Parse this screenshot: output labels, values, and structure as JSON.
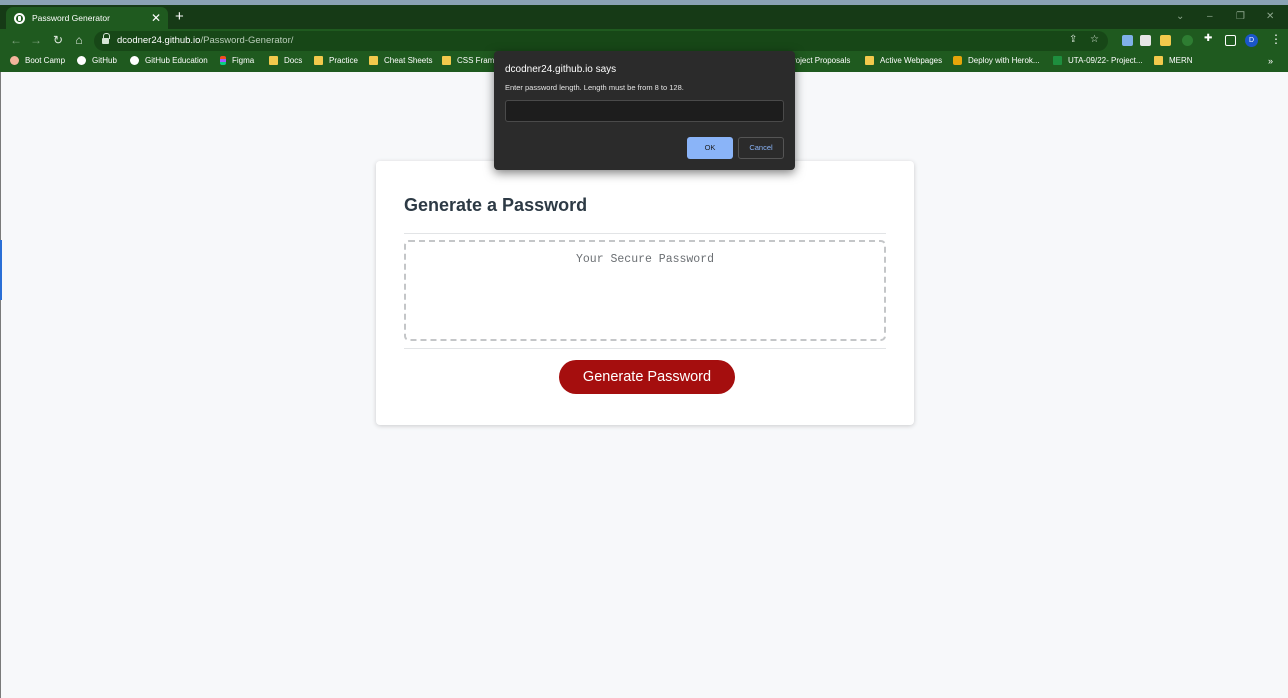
{
  "browser": {
    "tab": {
      "title": "Password Generator",
      "close": "✕"
    },
    "new_tab": "+",
    "window_controls": {
      "minimize": "–",
      "restore": "❐",
      "close": "✕",
      "tab_search": "⌄"
    },
    "url_host": "dcodner24.github.io",
    "url_path": "/Password-Generator/",
    "profile_initial": "D",
    "bookmarks": [
      {
        "label": "Boot Camp",
        "icon": "boot-camp-icon"
      },
      {
        "label": "GitHub",
        "icon": "github-icon"
      },
      {
        "label": "GitHub Education",
        "icon": "github-icon"
      },
      {
        "label": "Figma",
        "icon": "figma-icon"
      },
      {
        "label": "Docs",
        "icon": "folder-icon"
      },
      {
        "label": "Practice",
        "icon": "folder-icon"
      },
      {
        "label": "Cheat Sheets",
        "icon": "folder-icon"
      },
      {
        "label": "CSS Frame",
        "icon": "folder-icon"
      },
      {
        "label": "roject Proposals",
        "icon": "folder-icon"
      },
      {
        "label": "Active Webpages",
        "icon": "folder-icon"
      },
      {
        "label": "Deploy with Herok...",
        "icon": "heroku-icon"
      },
      {
        "label": "UTA-09/22- Project...",
        "icon": "sheets-icon"
      },
      {
        "label": "MERN",
        "icon": "folder-icon"
      }
    ]
  },
  "page": {
    "heading": "Generate a Password",
    "password_placeholder": "Your Secure Password",
    "generate_button": "Generate Password"
  },
  "dialog": {
    "title": "dcodner24.github.io says",
    "message": "Enter password length. Length must be from 8 to 128.",
    "input_value": "",
    "ok_label": "OK",
    "cancel_label": "Cancel"
  },
  "colors": {
    "browser_frame": "#1f5a1f",
    "button": "#a50e0e",
    "dialog_ok": "#8ab4f8"
  }
}
